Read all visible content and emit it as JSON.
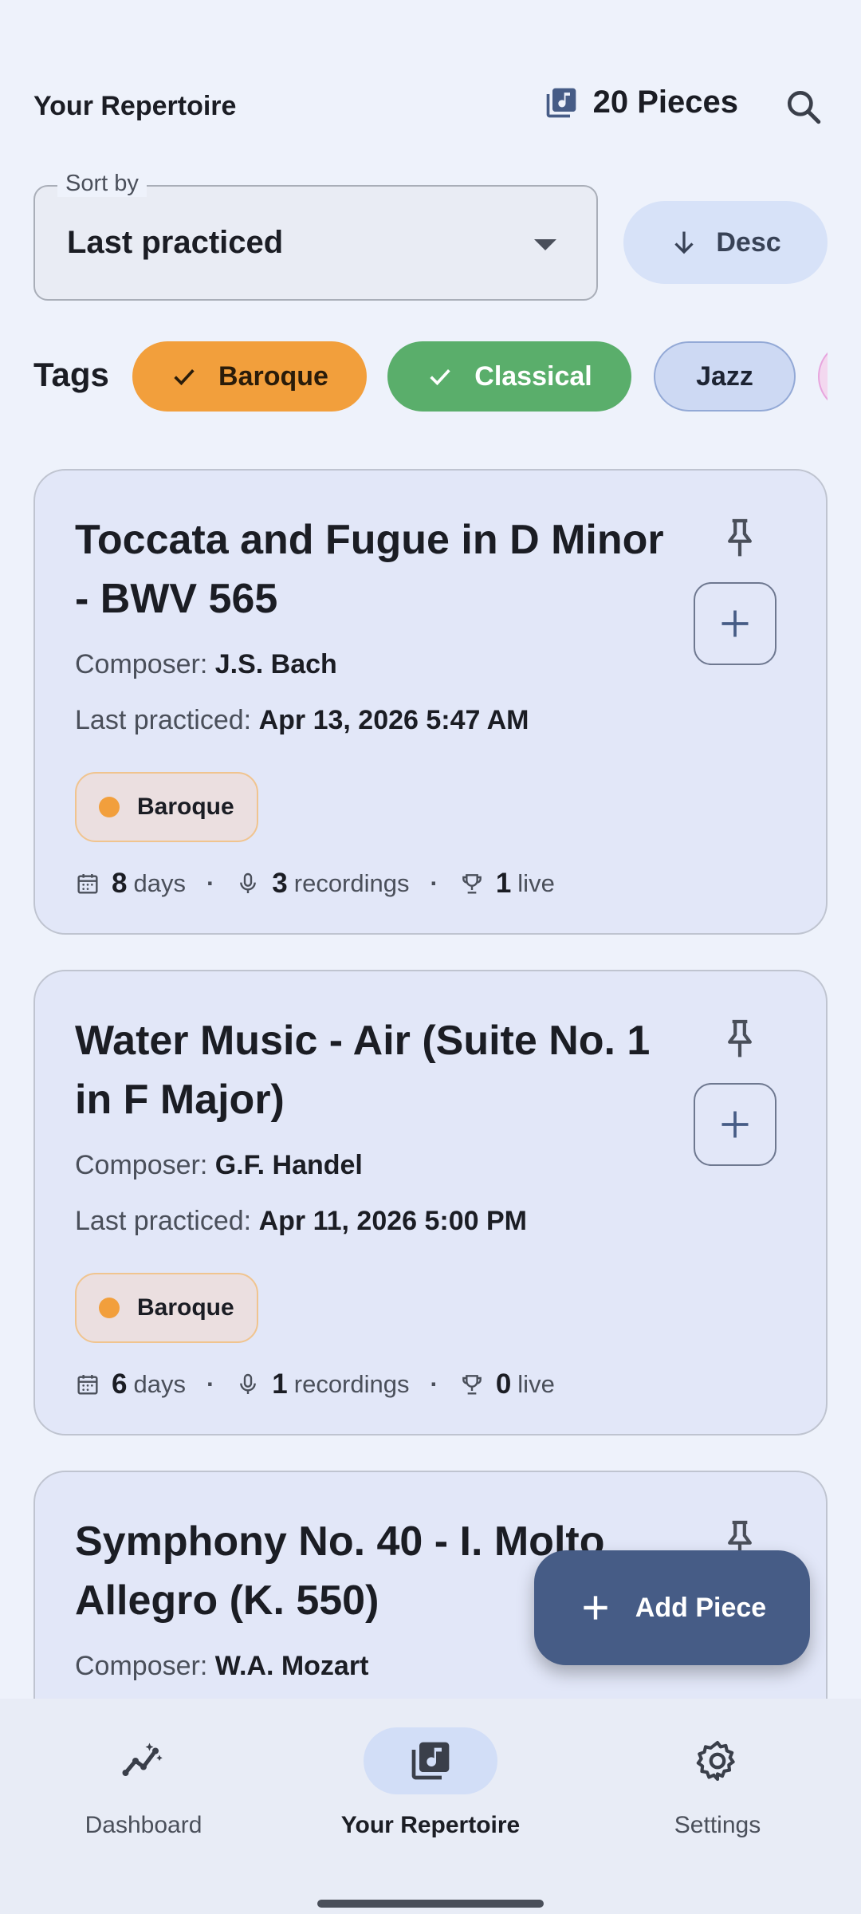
{
  "header": {
    "title": "Your Repertoire",
    "piece_count": "20 Pieces"
  },
  "sort": {
    "legend": "Sort by",
    "value": "Last practiced",
    "direction": "Desc"
  },
  "tags": {
    "label": "Tags",
    "chips": [
      {
        "label": "Baroque",
        "selected": true,
        "color": "#f29f3c"
      },
      {
        "label": "Classical",
        "selected": true,
        "color": "#5aae6b"
      },
      {
        "label": "Jazz",
        "selected": false,
        "color": "#cdd9f3"
      }
    ]
  },
  "pieces": [
    {
      "title": "Toccata and Fugue in D Minor - BWV 565",
      "composer_label": "Composer:",
      "composer": "J.S. Bach",
      "last_label": "Last practiced:",
      "last": "Apr 13, 2026 5:47 AM",
      "tag": "Baroque",
      "days": "8",
      "days_label": "days",
      "recordings": "3",
      "recordings_label": "recordings",
      "live": "1",
      "live_label": "live"
    },
    {
      "title": "Water Music - Air (Suite No. 1 in F Major)",
      "composer_label": "Composer:",
      "composer": "G.F. Handel",
      "last_label": "Last practiced:",
      "last": "Apr 11, 2026 5:00 PM",
      "tag": "Baroque",
      "days": "6",
      "days_label": "days",
      "recordings": "1",
      "recordings_label": "recordings",
      "live": "0",
      "live_label": "live"
    },
    {
      "title": "Symphony No. 40 - I. Molto Allegro (K. 550)",
      "composer_label": "Composer:",
      "composer": "W.A. Mozart"
    }
  ],
  "fab": {
    "label": "Add Piece"
  },
  "nav": {
    "dashboard": "Dashboard",
    "repertoire": "Your Repertoire",
    "settings": "Settings"
  },
  "colors": {
    "background": "#eef2fb",
    "card": "#e2e7f8",
    "accent": "#465c86",
    "baroque": "#f29f3c",
    "classical": "#5aae6b"
  }
}
